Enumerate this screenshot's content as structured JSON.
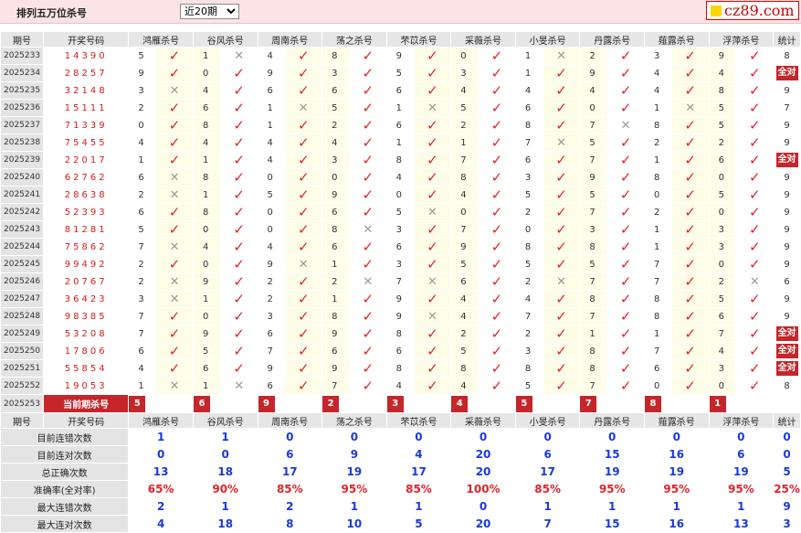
{
  "header": {
    "title": "排列五万位杀号",
    "range_selected": "近20期"
  },
  "logo": {
    "text": "cz89.com"
  },
  "columns": [
    "期号",
    "开奖号码",
    "鸿雁杀号",
    "谷风杀号",
    "周南杀号",
    "荡之杀号",
    "芣苡杀号",
    "采薇杀号",
    "小旻杀号",
    "丹露杀号",
    "薤露杀号",
    "浮萍杀号",
    "统计"
  ],
  "rows": [
    {
      "qi": "2025233",
      "kj": "14390",
      "n": [
        "5",
        "1",
        "4",
        "8",
        "9",
        "0",
        "1",
        "2",
        "3",
        "9"
      ],
      "r": [
        1,
        0,
        1,
        1,
        1,
        1,
        0,
        1,
        1,
        1
      ],
      "s": "8"
    },
    {
      "qi": "2025234",
      "kj": "28257",
      "n": [
        "9",
        "0",
        "9",
        "3",
        "5",
        "3",
        "1",
        "9",
        "4",
        "4"
      ],
      "r": [
        1,
        1,
        1,
        1,
        1,
        1,
        1,
        1,
        1,
        1
      ],
      "s": "全对"
    },
    {
      "qi": "2025235",
      "kj": "32148",
      "n": [
        "3",
        "4",
        "6",
        "6",
        "6",
        "4",
        "4",
        "4",
        "4",
        "8"
      ],
      "r": [
        0,
        1,
        1,
        1,
        1,
        1,
        1,
        1,
        1,
        1
      ],
      "s": "9"
    },
    {
      "qi": "2025236",
      "kj": "15111",
      "n": [
        "2",
        "6",
        "1",
        "5",
        "1",
        "5",
        "6",
        "0",
        "1",
        "5"
      ],
      "r": [
        1,
        1,
        0,
        1,
        0,
        1,
        1,
        1,
        0,
        1
      ],
      "s": "7"
    },
    {
      "qi": "2025237",
      "kj": "71339",
      "n": [
        "0",
        "8",
        "1",
        "2",
        "6",
        "2",
        "8",
        "7",
        "8",
        "5"
      ],
      "r": [
        1,
        1,
        1,
        1,
        1,
        1,
        1,
        0,
        1,
        1
      ],
      "s": "9"
    },
    {
      "qi": "2025238",
      "kj": "75455",
      "n": [
        "4",
        "4",
        "4",
        "4",
        "1",
        "1",
        "7",
        "5",
        "2",
        "2"
      ],
      "r": [
        1,
        1,
        1,
        1,
        1,
        1,
        0,
        1,
        1,
        1
      ],
      "s": "9"
    },
    {
      "qi": "2025239",
      "kj": "22017",
      "n": [
        "1",
        "1",
        "4",
        "3",
        "8",
        "7",
        "6",
        "7",
        "1",
        "6"
      ],
      "r": [
        1,
        1,
        1,
        1,
        1,
        1,
        1,
        1,
        1,
        1
      ],
      "s": "全对"
    },
    {
      "qi": "2025240",
      "kj": "62762",
      "n": [
        "6",
        "8",
        "0",
        "0",
        "4",
        "8",
        "3",
        "9",
        "8",
        "0"
      ],
      "r": [
        0,
        1,
        1,
        1,
        1,
        1,
        1,
        1,
        1,
        1
      ],
      "s": "9"
    },
    {
      "qi": "2025241",
      "kj": "28638",
      "n": [
        "2",
        "1",
        "5",
        "9",
        "0",
        "4",
        "5",
        "5",
        "0",
        "5"
      ],
      "r": [
        0,
        1,
        1,
        1,
        1,
        1,
        1,
        1,
        1,
        1
      ],
      "s": "9"
    },
    {
      "qi": "2025242",
      "kj": "52393",
      "n": [
        "6",
        "8",
        "0",
        "6",
        "5",
        "0",
        "2",
        "7",
        "2",
        "0"
      ],
      "r": [
        1,
        1,
        1,
        1,
        0,
        1,
        1,
        1,
        1,
        1
      ],
      "s": "9"
    },
    {
      "qi": "2025243",
      "kj": "81281",
      "n": [
        "5",
        "0",
        "0",
        "8",
        "3",
        "7",
        "0",
        "3",
        "1",
        "3"
      ],
      "r": [
        1,
        1,
        1,
        0,
        1,
        1,
        1,
        1,
        1,
        1
      ],
      "s": "9"
    },
    {
      "qi": "2025244",
      "kj": "75862",
      "n": [
        "7",
        "4",
        "4",
        "6",
        "6",
        "9",
        "8",
        "8",
        "1",
        "3"
      ],
      "r": [
        0,
        1,
        1,
        1,
        1,
        1,
        1,
        1,
        1,
        1
      ],
      "s": "9"
    },
    {
      "qi": "2025245",
      "kj": "99492",
      "n": [
        "2",
        "0",
        "9",
        "1",
        "3",
        "5",
        "5",
        "5",
        "7",
        "0"
      ],
      "r": [
        1,
        1,
        0,
        1,
        1,
        1,
        1,
        1,
        1,
        1
      ],
      "s": "9"
    },
    {
      "qi": "2025246",
      "kj": "20767",
      "n": [
        "2",
        "9",
        "2",
        "2",
        "7",
        "6",
        "2",
        "7",
        "7",
        "2"
      ],
      "r": [
        0,
        1,
        1,
        0,
        0,
        1,
        0,
        1,
        1,
        0
      ],
      "s": "6"
    },
    {
      "qi": "2025247",
      "kj": "36423",
      "n": [
        "3",
        "1",
        "2",
        "1",
        "9",
        "4",
        "4",
        "8",
        "8",
        "5"
      ],
      "r": [
        0,
        1,
        1,
        1,
        1,
        1,
        1,
        1,
        1,
        1
      ],
      "s": "9"
    },
    {
      "qi": "2025248",
      "kj": "98385",
      "n": [
        "7",
        "0",
        "3",
        "8",
        "9",
        "4",
        "7",
        "7",
        "8",
        "6"
      ],
      "r": [
        1,
        1,
        1,
        1,
        0,
        1,
        1,
        1,
        1,
        1
      ],
      "s": "9"
    },
    {
      "qi": "2025249",
      "kj": "53208",
      "n": [
        "7",
        "9",
        "6",
        "9",
        "8",
        "2",
        "2",
        "1",
        "1",
        "7"
      ],
      "r": [
        1,
        1,
        1,
        1,
        1,
        1,
        1,
        1,
        1,
        1
      ],
      "s": "全对"
    },
    {
      "qi": "2025250",
      "kj": "17806",
      "n": [
        "6",
        "5",
        "7",
        "6",
        "6",
        "5",
        "3",
        "8",
        "7",
        "4"
      ],
      "r": [
        1,
        1,
        1,
        1,
        1,
        1,
        1,
        1,
        1,
        1
      ],
      "s": "全对"
    },
    {
      "qi": "2025251",
      "kj": "55854",
      "n": [
        "4",
        "6",
        "9",
        "9",
        "8",
        "8",
        "8",
        "8",
        "6",
        "3"
      ],
      "r": [
        1,
        1,
        1,
        1,
        1,
        1,
        1,
        1,
        1,
        1
      ],
      "s": "全对"
    },
    {
      "qi": "2025252",
      "kj": "19053",
      "n": [
        "1",
        "1",
        "6",
        "7",
        "4",
        "4",
        "5",
        "7",
        "0",
        "0"
      ],
      "r": [
        0,
        0,
        1,
        1,
        1,
        1,
        1,
        1,
        1,
        1
      ],
      "s": "8"
    }
  ],
  "current": {
    "qi": "2025253",
    "label": "当前期杀号",
    "nums": [
      "5",
      "6",
      "9",
      "2",
      "3",
      "4",
      "5",
      "7",
      "8",
      "1"
    ]
  },
  "stats": [
    {
      "label": "目前连错次数",
      "vals": [
        "1",
        "1",
        "0",
        "0",
        "0",
        "0",
        "0",
        "0",
        "0",
        "0",
        "0"
      ],
      "red": false
    },
    {
      "label": "目前连对次数",
      "vals": [
        "0",
        "0",
        "6",
        "9",
        "4",
        "20",
        "6",
        "15",
        "16",
        "6",
        "0"
      ],
      "red": false
    },
    {
      "label": "总正确次数",
      "vals": [
        "13",
        "18",
        "17",
        "19",
        "17",
        "20",
        "17",
        "19",
        "19",
        "19",
        "5"
      ],
      "red": false
    },
    {
      "label": "准确率(全对率)",
      "vals": [
        "65%",
        "90%",
        "85%",
        "95%",
        "85%",
        "100%",
        "85%",
        "95%",
        "95%",
        "95%",
        "25%"
      ],
      "red": true
    },
    {
      "label": "最大连错次数",
      "vals": [
        "2",
        "1",
        "2",
        "1",
        "1",
        "0",
        "1",
        "1",
        "1",
        "1",
        "9"
      ],
      "red": false
    },
    {
      "label": "最大连对次数",
      "vals": [
        "4",
        "18",
        "8",
        "10",
        "5",
        "20",
        "7",
        "15",
        "16",
        "13",
        "3"
      ],
      "red": false
    }
  ],
  "marks": {
    "correct": "✓",
    "wrong": "✕"
  },
  "colors": {
    "accent_red": "#c6252a",
    "check_red": "#e0242c",
    "stat_blue": "#1a3ad6",
    "header_pink": "#fce4e6"
  }
}
